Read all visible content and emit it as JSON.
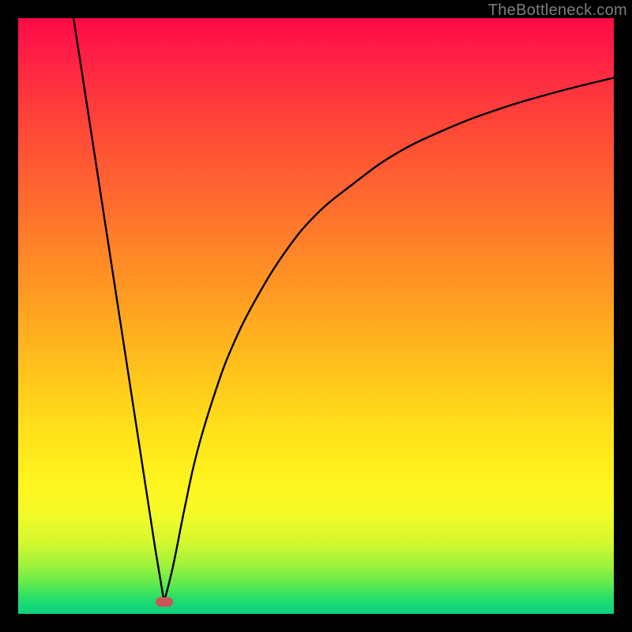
{
  "watermark": "TheBottleneck.com",
  "colors": {
    "frame": "#000000",
    "gradient_top": "#ff0a46",
    "gradient_bottom": "#0fd37f",
    "curve": "#000000",
    "marker": "#cb5658",
    "watermark_text": "#7d7d7d"
  },
  "chart_data": {
    "type": "line",
    "title": "",
    "xlabel": "",
    "ylabel": "",
    "xlim": [
      0,
      100
    ],
    "ylim": [
      0,
      100
    ],
    "grid": false,
    "legend": false,
    "series": [
      {
        "name": "left-branch",
        "x": [
          9.3,
          11,
          13,
          15,
          17,
          19,
          21,
          23,
          24.5
        ],
        "y": [
          100,
          89,
          76,
          63,
          50,
          37,
          24,
          11,
          2
        ]
      },
      {
        "name": "right-branch",
        "x": [
          24.5,
          26,
          28,
          30,
          33,
          36,
          40,
          45,
          50,
          56,
          63,
          71,
          80,
          90,
          100
        ],
        "y": [
          2,
          8,
          18,
          27,
          37,
          45,
          53,
          61,
          67,
          72,
          77,
          81,
          84.5,
          87.5,
          90
        ]
      }
    ],
    "marker": {
      "x": 24.5,
      "y": 2,
      "shape": "pill",
      "color": "#cb5658"
    },
    "background_gradient": {
      "direction": "vertical",
      "stops": [
        {
          "pos": 0,
          "color": "#ff0a46"
        },
        {
          "pos": 50,
          "color": "#ff9a22"
        },
        {
          "pos": 78,
          "color": "#fff41e"
        },
        {
          "pos": 100,
          "color": "#0fd37f"
        }
      ]
    }
  }
}
